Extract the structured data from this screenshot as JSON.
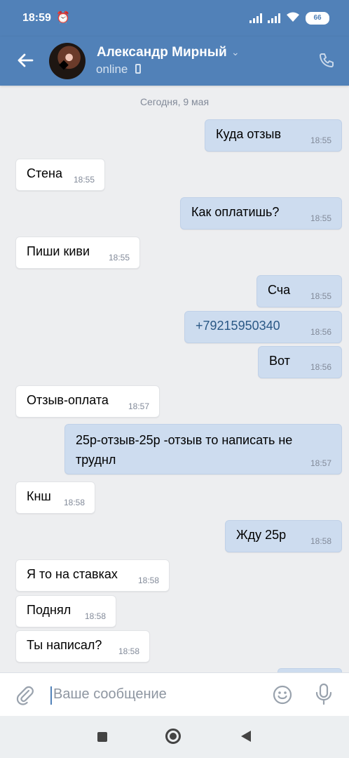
{
  "status_bar": {
    "time": "18:59",
    "battery": "66"
  },
  "header": {
    "contact_name": "Александр Мирный",
    "contact_status": "online"
  },
  "chat": {
    "date_separator": "Сегодня, 9 мая",
    "messages": [
      {
        "direction": "out",
        "text": "Куда отзыв",
        "time": "18:55"
      },
      {
        "direction": "in",
        "text": "Стена",
        "time": "18:55"
      },
      {
        "direction": "out",
        "text": "Как оплатишь?",
        "time": "18:55"
      },
      {
        "direction": "in",
        "text": "Пиши киви",
        "time": "18:55"
      },
      {
        "direction": "out",
        "text": "Сча",
        "time": "18:55"
      },
      {
        "direction": "out",
        "text": "+79215950340",
        "time": "18:56"
      },
      {
        "direction": "out",
        "text": "Вот",
        "time": "18:56"
      },
      {
        "direction": "in",
        "text": "Отзыв-оплата",
        "time": "18:57"
      },
      {
        "direction": "out",
        "text": "25р-отзыв-25р -отзыв то написать не труднл",
        "time": "18:57"
      },
      {
        "direction": "in",
        "text": "Кнш",
        "time": "18:58"
      },
      {
        "direction": "out",
        "text": "Жду 25р",
        "time": "18:58"
      },
      {
        "direction": "in",
        "text": "Я то на ставках",
        "time": "18:58"
      },
      {
        "direction": "in",
        "text": "Поднял",
        "time": "18:58"
      },
      {
        "direction": "in",
        "text": "Ты написал?",
        "time": "18:58"
      }
    ]
  },
  "composer": {
    "placeholder": "Ваше сообщение"
  },
  "icons": {
    "back": "arrow-left-icon",
    "call": "phone-icon",
    "attach": "paperclip-icon",
    "emoji": "smile-icon",
    "voice": "microphone-icon",
    "mobile": "mobile-device-icon",
    "alarm": "alarm-icon"
  },
  "colors": {
    "header": "#5181b8",
    "outgoing_bubble": "#cddcef",
    "incoming_bubble": "#ffffff",
    "background": "#edeef0"
  }
}
